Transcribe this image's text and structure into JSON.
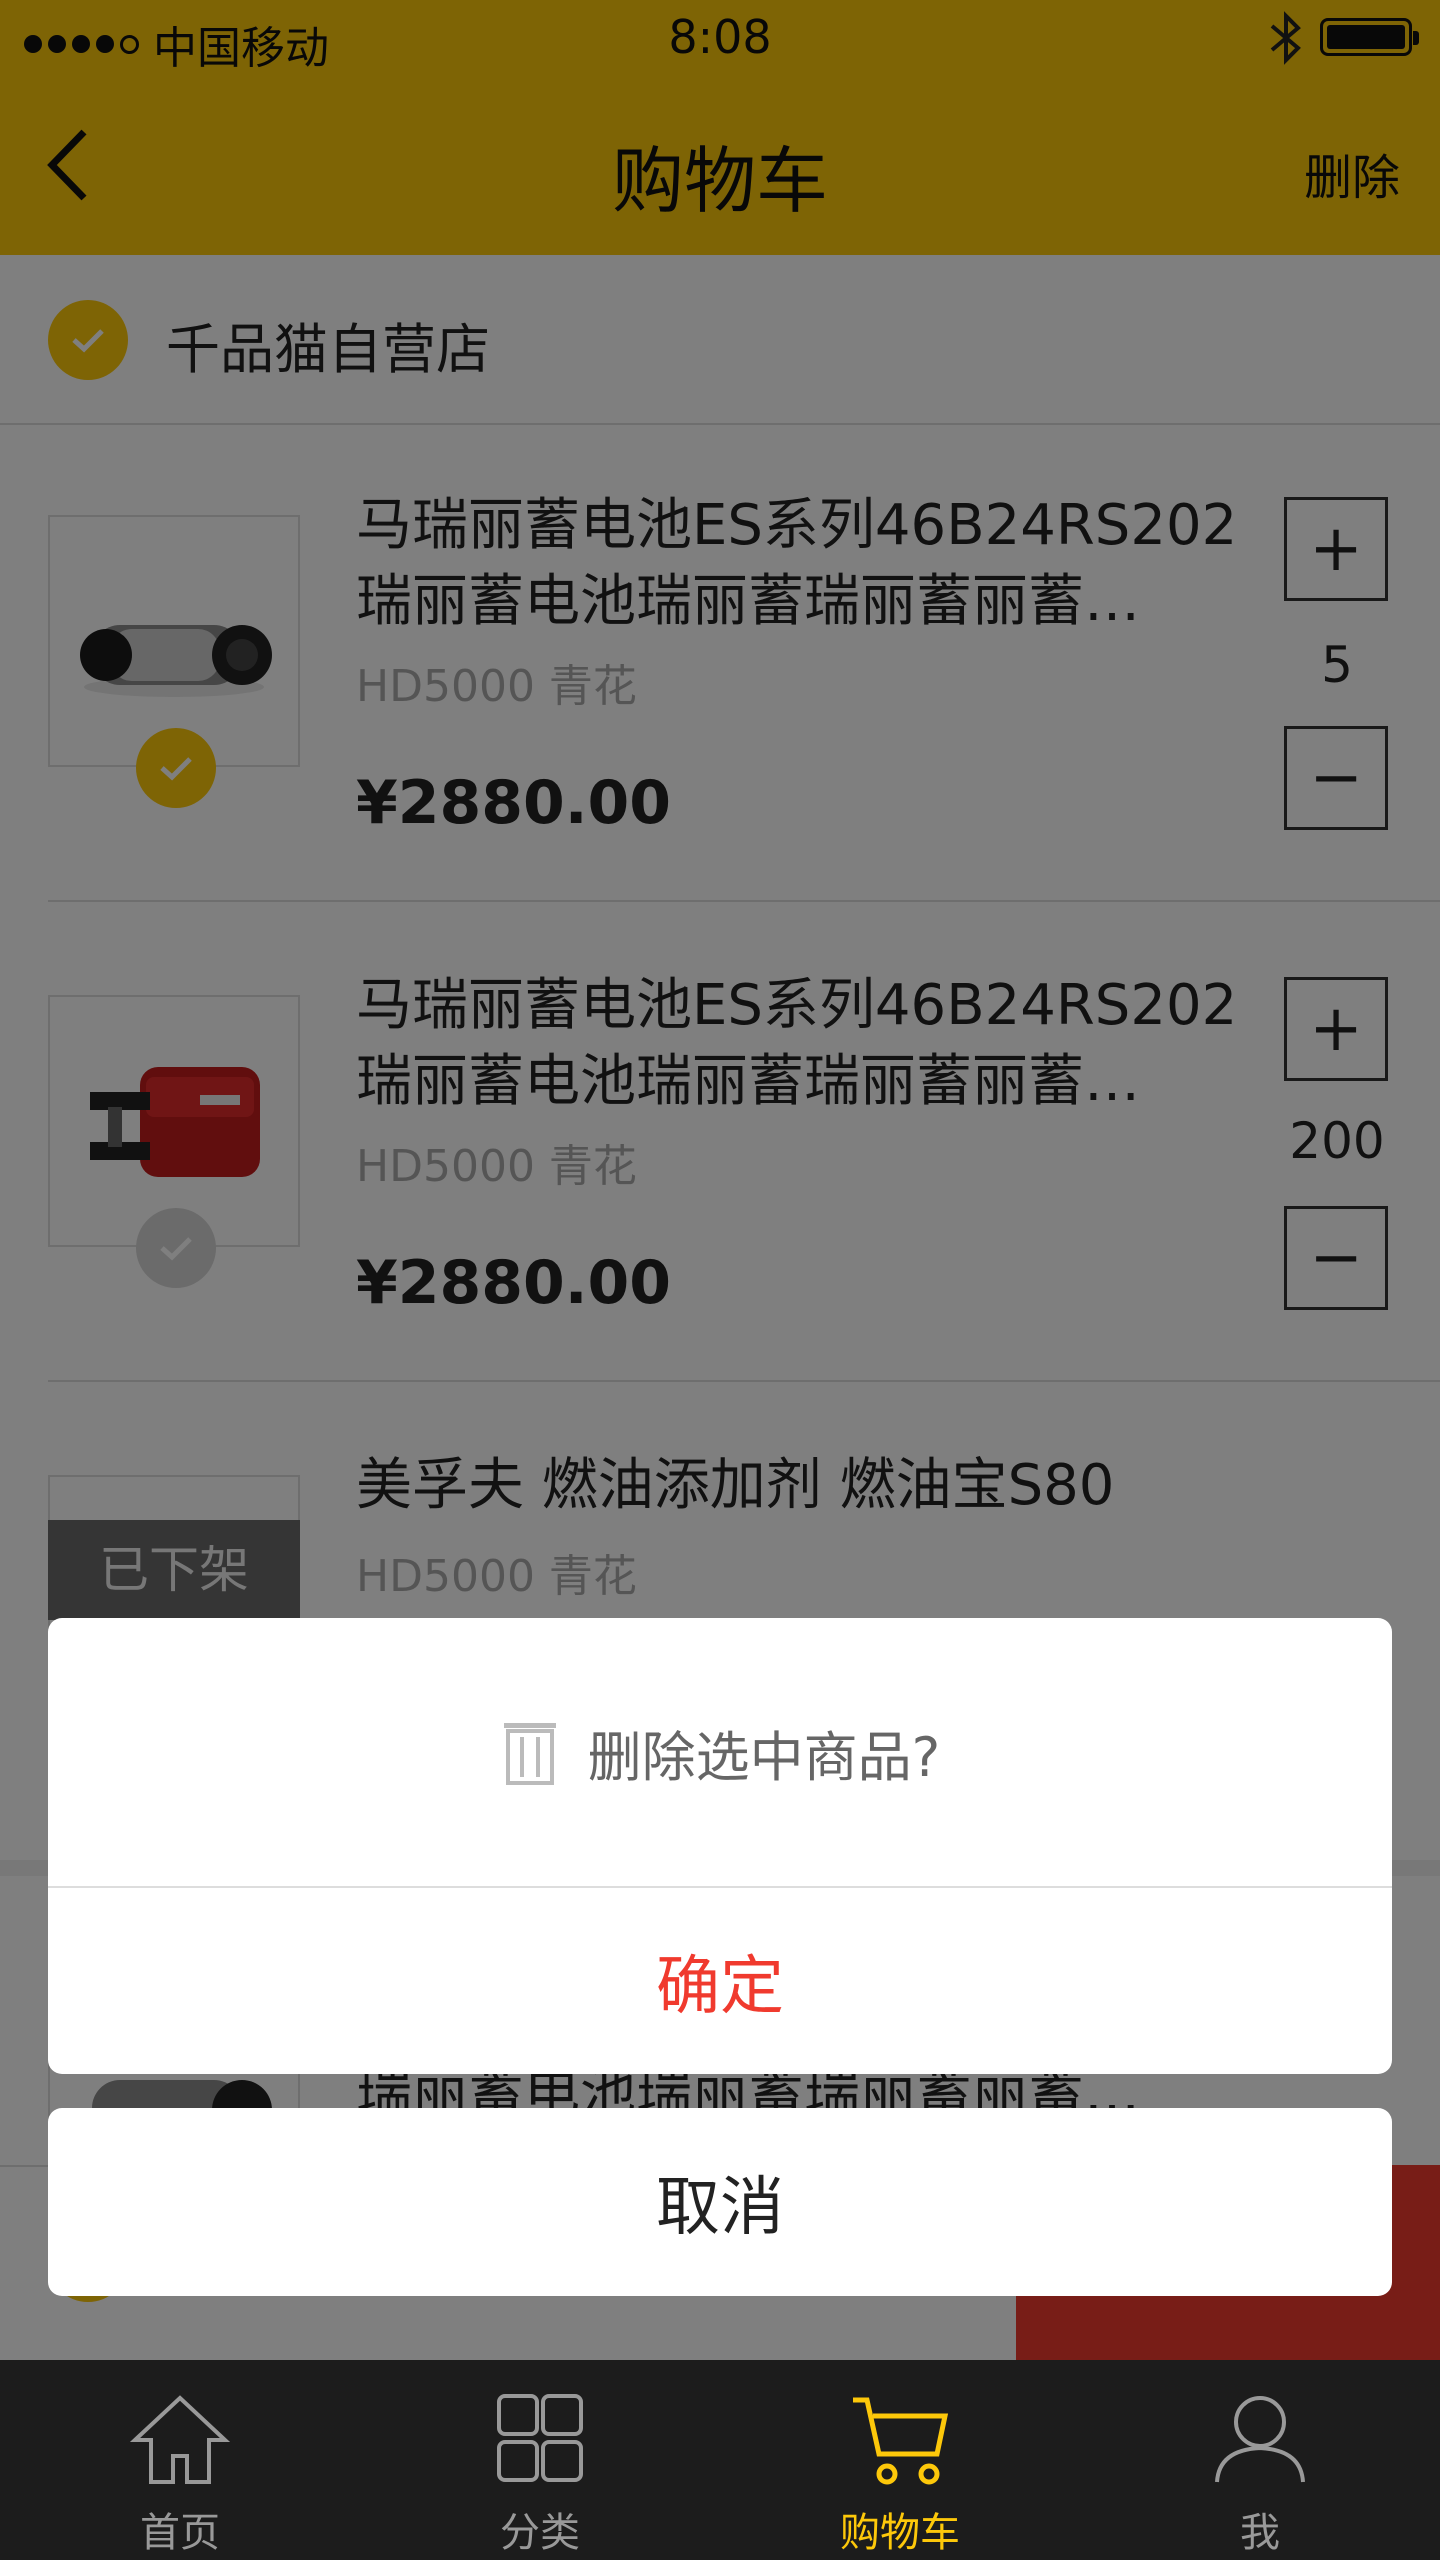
{
  "status_bar": {
    "carrier": "中国移动",
    "time": "8:08"
  },
  "nav": {
    "title": "购物车",
    "action": "删除"
  },
  "store": {
    "name": "千品猫自营店",
    "checked": true
  },
  "items": [
    {
      "title_line1": "马瑞丽蓄电池ES系列46B24RS202",
      "title_line2": "瑞丽蓄电池瑞丽蓄瑞丽蓄丽蓄…",
      "spec": "HD5000 青花",
      "price": "¥2880.00",
      "qty": "5",
      "checked": true
    },
    {
      "title_line1": "马瑞丽蓄电池ES系列46B24RS202",
      "title_line2": "瑞丽蓄电池瑞丽蓄瑞丽蓄丽蓄…",
      "spec": "HD5000 青花",
      "price": "¥2880.00",
      "qty": "200",
      "checked": false
    },
    {
      "title_line1": "美孚夫 燃油添加剂 燃油宝S80",
      "spec": "HD5000 青花",
      "status": "已下架"
    }
  ],
  "partial_item": {
    "title_line2": "瑞丽蓄电池瑞丽蓄瑞丽蓄丽蓄…"
  },
  "qty_controls": {
    "plus": "+",
    "minus": "−"
  },
  "dialog": {
    "title": "删除选中商品?",
    "confirm": "确定",
    "cancel": "取消"
  },
  "tabbar": [
    {
      "label": "首页",
      "icon": "home-icon"
    },
    {
      "label": "分类",
      "icon": "category-icon"
    },
    {
      "label": "购物车",
      "icon": "cart-icon",
      "active": true
    },
    {
      "label": "我",
      "icon": "user-icon"
    }
  ],
  "colors": {
    "accent": "#fdc80a",
    "danger": "#f03a2e",
    "tabbar_bg": "#1c1c1c"
  }
}
